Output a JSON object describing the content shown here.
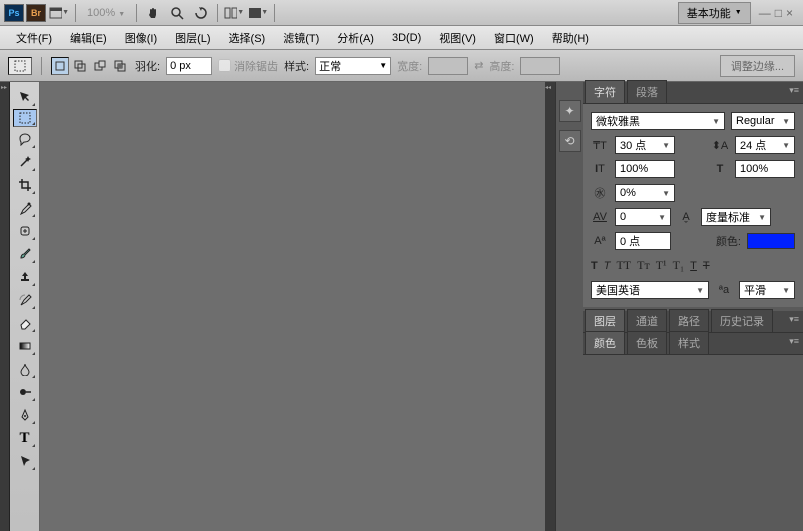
{
  "topbar": {
    "ps": "Ps",
    "br": "Br",
    "zoom": "100%",
    "workspace": "基本功能"
  },
  "menu": [
    "文件(F)",
    "编辑(E)",
    "图像(I)",
    "图层(L)",
    "选择(S)",
    "滤镜(T)",
    "分析(A)",
    "3D(D)",
    "视图(V)",
    "窗口(W)",
    "帮助(H)"
  ],
  "opt": {
    "feather_lbl": "羽化:",
    "feather_val": "0 px",
    "antialias": "消除锯齿",
    "style_lbl": "样式:",
    "style_val": "正常",
    "width_lbl": "宽度:",
    "height_lbl": "高度:",
    "refine": "调整边缘..."
  },
  "char": {
    "tabs": [
      "字符",
      "段落"
    ],
    "font": "微软雅黑",
    "weight": "Regular",
    "size": "30 点",
    "leading": "24 点",
    "vscale": "100%",
    "hscale": "100%",
    "tracking": "0%",
    "kerning": "0",
    "metrics": "度量标准",
    "baseline": "0 点",
    "color_lbl": "颜色:",
    "lang": "美国英语",
    "aa": "平滑"
  },
  "pgrp1": [
    "图层",
    "通道",
    "路径",
    "历史记录"
  ],
  "pgrp2": [
    "颜色",
    "色板",
    "样式"
  ]
}
